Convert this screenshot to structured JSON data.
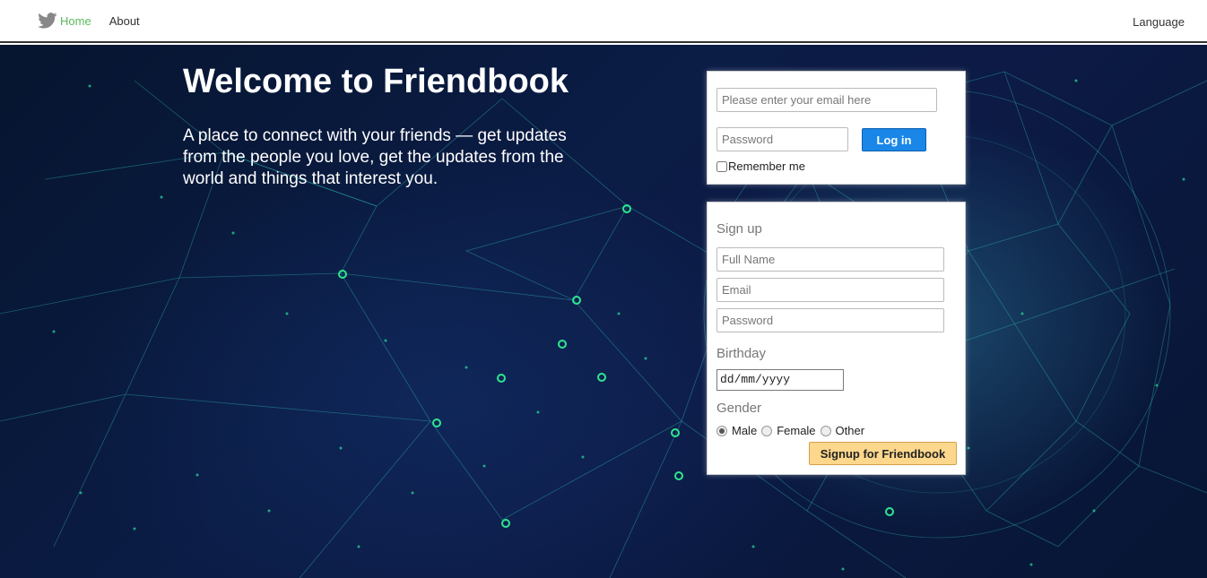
{
  "nav": {
    "home": "Home",
    "about": "About",
    "language": "Language",
    "logo_icon": "twitter-bird-icon"
  },
  "hero": {
    "title": "Welcome to Friendbook",
    "tagline": "A place to connect with your friends — get updates from the people you love, get the updates from the world and things that interest you."
  },
  "login": {
    "email_placeholder": "Please enter your email here",
    "password_placeholder": "Password",
    "login_label": "Log in",
    "remember_label": "Remember me"
  },
  "signup": {
    "heading": "Sign up",
    "fullname_placeholder": "Full Name",
    "email_placeholder": "Email",
    "password_placeholder": "Password",
    "birthday_label": "Birthday",
    "birthday_value": "dd/mm/yyyy",
    "gender_label": "Gender",
    "gender_options": [
      "Male",
      "Female",
      "Other"
    ],
    "gender_selected": "Male",
    "submit_label": "Signup for Friendbook"
  },
  "colors": {
    "home_link": "#5cb85c",
    "login_button": "#1a86e8",
    "signup_button": "#fcd78c",
    "hero_dark": "#0b1c45",
    "network_accent": "#3ad8c0"
  }
}
